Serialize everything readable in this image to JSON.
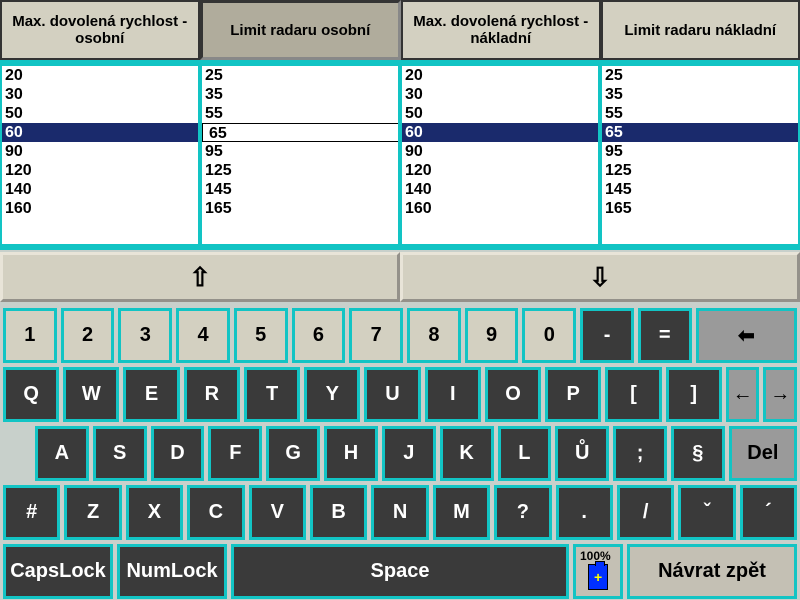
{
  "headers": [
    {
      "label": "Max. dovolená rychlost - osobní",
      "selected": false
    },
    {
      "label": "Limit radaru osobní",
      "selected": true
    },
    {
      "label": "Max. dovolená rychlost - nákladní",
      "selected": false
    },
    {
      "label": "Limit radaru nákladní",
      "selected": false
    }
  ],
  "columns": [
    {
      "items": [
        "20",
        "30",
        "50",
        "60",
        "90",
        "120",
        "140",
        "160"
      ],
      "selIdx": 3,
      "editing": false
    },
    {
      "items": [
        "25",
        "35",
        "55",
        "65",
        "95",
        "125",
        "145",
        "165"
      ],
      "selIdx": 3,
      "editing": true
    },
    {
      "items": [
        "20",
        "30",
        "50",
        "60",
        "90",
        "120",
        "140",
        "160"
      ],
      "selIdx": 3,
      "editing": false
    },
    {
      "items": [
        "25",
        "35",
        "55",
        "65",
        "95",
        "125",
        "145",
        "165"
      ],
      "selIdx": 3,
      "editing": false
    }
  ],
  "arrows": {
    "up": "⇧",
    "down": "⇩"
  },
  "kb": {
    "r1": [
      "1",
      "2",
      "3",
      "4",
      "5",
      "6",
      "7",
      "8",
      "9",
      "0",
      "-",
      "=",
      "⬅"
    ],
    "r2": [
      "Q",
      "W",
      "E",
      "R",
      "T",
      "Y",
      "U",
      "I",
      "O",
      "P",
      "[",
      "]",
      "←",
      "→"
    ],
    "r3": [
      "A",
      "S",
      "D",
      "F",
      "G",
      "H",
      "J",
      "K",
      "L",
      "Ů",
      ";",
      "§",
      "Del"
    ],
    "r4": [
      "#",
      "Z",
      "X",
      "C",
      "V",
      "B",
      "N",
      "M",
      "?",
      ".",
      "/",
      "ˇ",
      "´"
    ],
    "r5": {
      "caps": "CapsLock",
      "num": "NumLock",
      "space": "Space",
      "back": "Návrat zpět",
      "bat": "100%"
    }
  }
}
